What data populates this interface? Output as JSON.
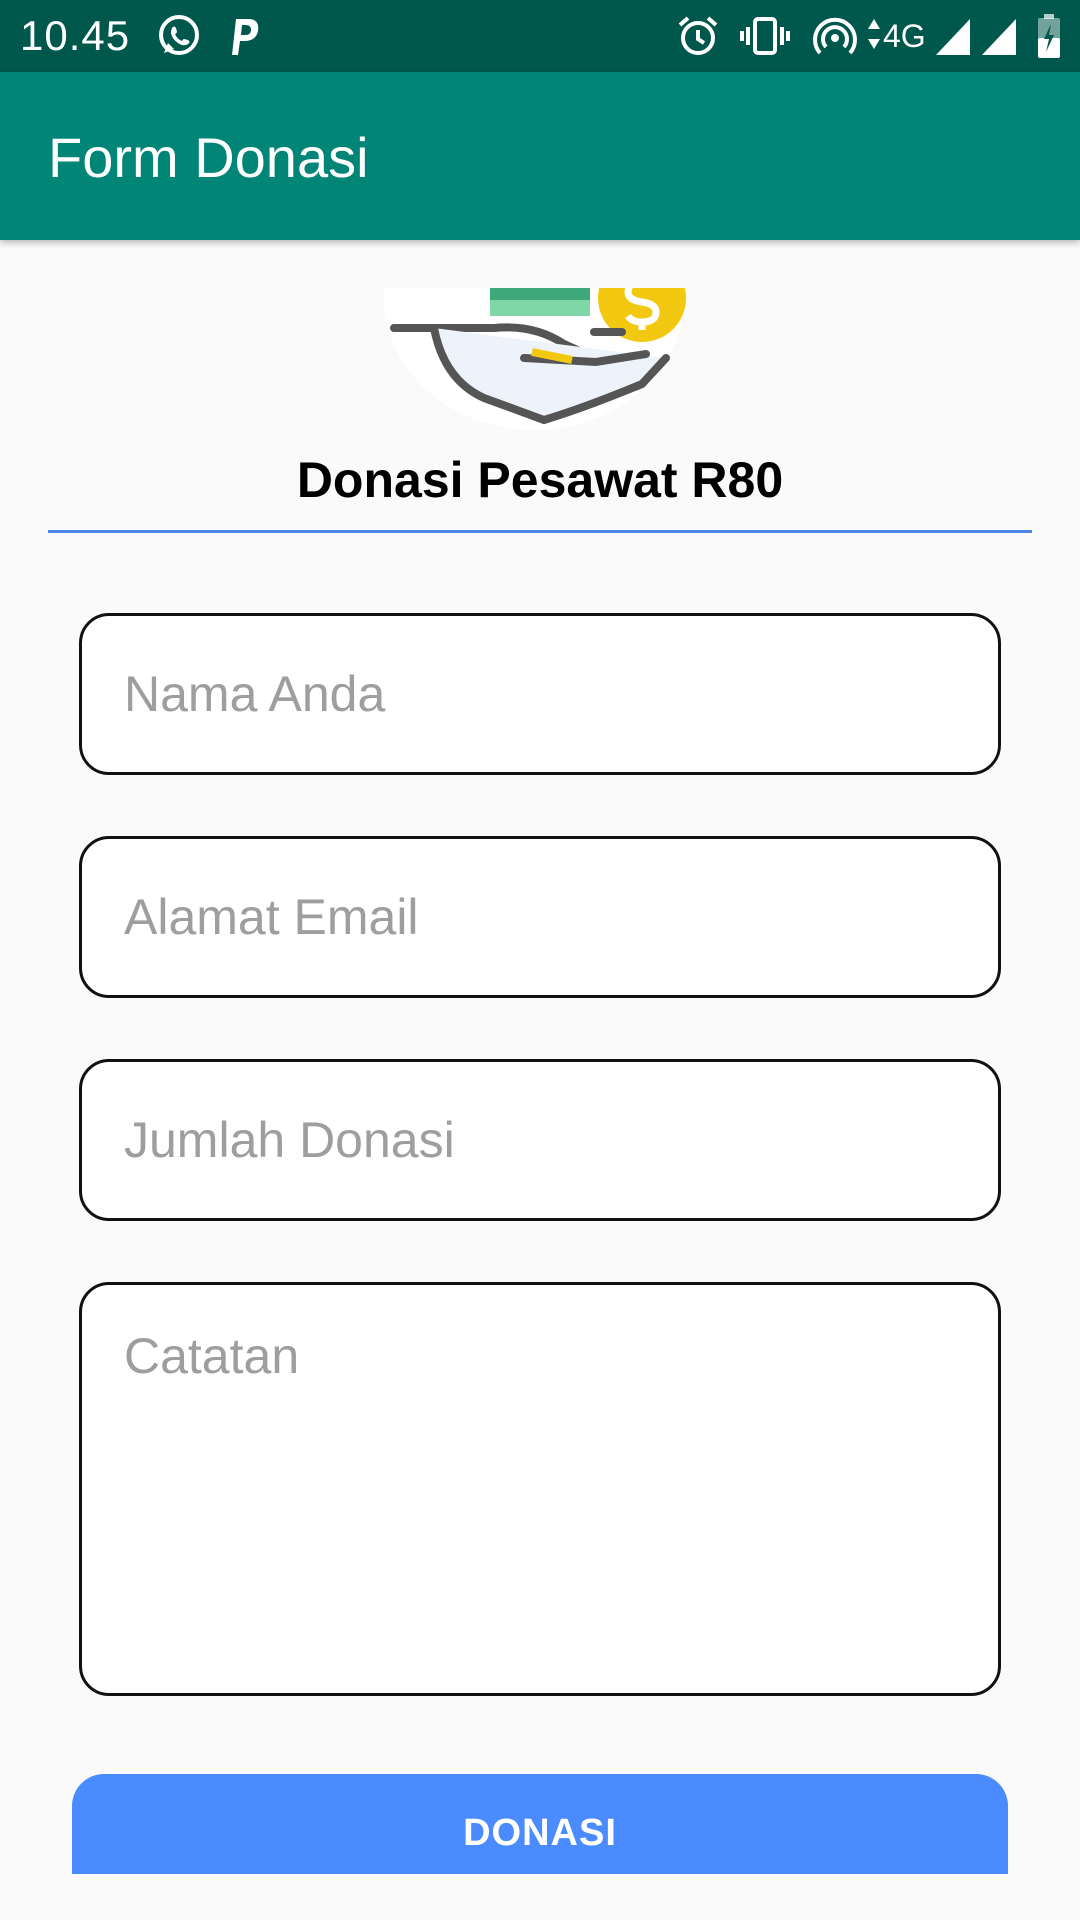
{
  "status_bar": {
    "time": "10.45",
    "network": "4G",
    "icons": [
      "whatsapp-icon",
      "p-app-icon",
      "alarm-icon",
      "vibrate-icon",
      "hotspot-icon",
      "signal-icon",
      "signal-icon",
      "battery-charging-icon"
    ]
  },
  "app_bar": {
    "title": "Form Donasi"
  },
  "header": {
    "title": "Donasi Pesawat R80"
  },
  "form": {
    "name_placeholder": "Nama Anda",
    "email_placeholder": "Alamat Email",
    "amount_placeholder": "Jumlah Donasi",
    "notes_placeholder": "Catatan",
    "submit_label": "DONASI"
  },
  "colors": {
    "status_bar": "#00574b",
    "app_bar": "#008577",
    "accent": "#4a8cff",
    "divider": "#4a86e8"
  }
}
